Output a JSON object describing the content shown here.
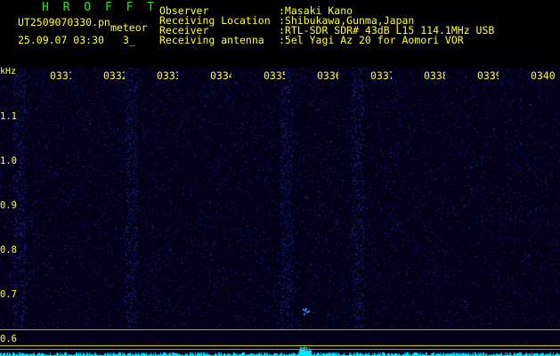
{
  "header": {
    "brand": "H R O F F T",
    "file_name": "UT2509070330.pn",
    "file_tag": "meteor",
    "date_time": "25.09.07 03:30",
    "count": "3_",
    "info": [
      {
        "label": "Observer",
        "value": ":Masaki Kano"
      },
      {
        "label": "Receiving Location",
        "value": ":Shibukawa,Gunma,Japan"
      },
      {
        "label": "Receiver",
        "value": ":RTL-SDR SDR# 43dB L15 114.1MHz USB"
      },
      {
        "label": "Receiving antenna",
        "value": ":5el Yagi Az 20 for Aomori VOR"
      }
    ]
  },
  "spectrogram": {
    "unit_label": "kHz",
    "time_ticks": [
      "0331",
      "0332",
      "0333",
      "0334",
      "0335",
      "0336",
      "0337",
      "0338",
      "0339",
      "0340"
    ],
    "freq_ticks": [
      "1.1",
      "1.0",
      "0.9",
      "0.8",
      "0.7",
      "0.6"
    ]
  },
  "colors": {
    "text": "#ffff33",
    "brand": "#22e622",
    "background": "#030018",
    "signal": "#3a8cff",
    "spectrum": "#00e5ff"
  }
}
